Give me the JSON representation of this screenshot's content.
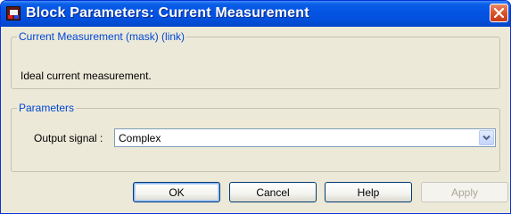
{
  "window": {
    "title": "Block Parameters: Current Measurement"
  },
  "description_group": {
    "legend": "Current Measurement (mask) (link)",
    "text": "Ideal current measurement."
  },
  "parameters_group": {
    "legend": "Parameters",
    "output_signal": {
      "label": "Output signal :",
      "value": "Complex"
    }
  },
  "buttons": {
    "ok": "OK",
    "cancel": "Cancel",
    "help": "Help",
    "apply": "Apply"
  },
  "colors": {
    "titlebar": "#0554e3",
    "legend_text": "#0046d5",
    "dialog_bg": "#ece9d8",
    "close_button": "#d8542c"
  },
  "icons": {
    "app": "simulink-block-icon",
    "close": "close-icon",
    "dropdown": "chevron-down-icon"
  }
}
